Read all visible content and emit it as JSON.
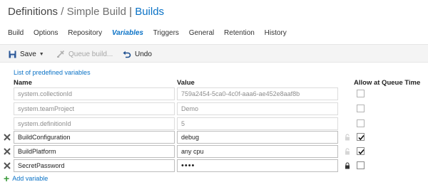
{
  "header": {
    "definitions": "Definitions",
    "slash": "/",
    "build_name": "Simple Build",
    "bar": "|",
    "builds_link": "Builds"
  },
  "tabs": [
    {
      "label": "Build",
      "active": false
    },
    {
      "label": "Options",
      "active": false
    },
    {
      "label": "Repository",
      "active": false
    },
    {
      "label": "Variables",
      "active": true
    },
    {
      "label": "Triggers",
      "active": false
    },
    {
      "label": "General",
      "active": false
    },
    {
      "label": "Retention",
      "active": false
    },
    {
      "label": "History",
      "active": false
    }
  ],
  "toolbar": {
    "save_label": "Save",
    "queue_label": "Queue build...",
    "undo_label": "Undo"
  },
  "predefined_link": "List of predefined variables",
  "columns": {
    "name": "Name",
    "value": "Value",
    "allow": "Allow at Queue Time"
  },
  "variables": [
    {
      "name": "system.collectionId",
      "value": "759a2454-5ca0-4c0f-aaa6-ae452e8aaf8b",
      "readonly": true,
      "checked": false
    },
    {
      "name": "system.teamProject",
      "value": "Demo",
      "readonly": true,
      "checked": false
    },
    {
      "name": "system.definitionId",
      "value": "5",
      "readonly": true,
      "checked": false
    },
    {
      "name": "BuildConfiguration",
      "value": "debug",
      "readonly": false,
      "checked": true
    },
    {
      "name": "BuildPlatform",
      "value": "any cpu",
      "readonly": false,
      "checked": true
    },
    {
      "name": "SecretPassword",
      "value": "••••",
      "readonly": false,
      "checked": false,
      "secret": true
    }
  ],
  "add_variable": "Add variable",
  "colors": {
    "accent": "#0a72c6",
    "add_plus": "#3a9a3a",
    "delete_x": "#555555"
  }
}
